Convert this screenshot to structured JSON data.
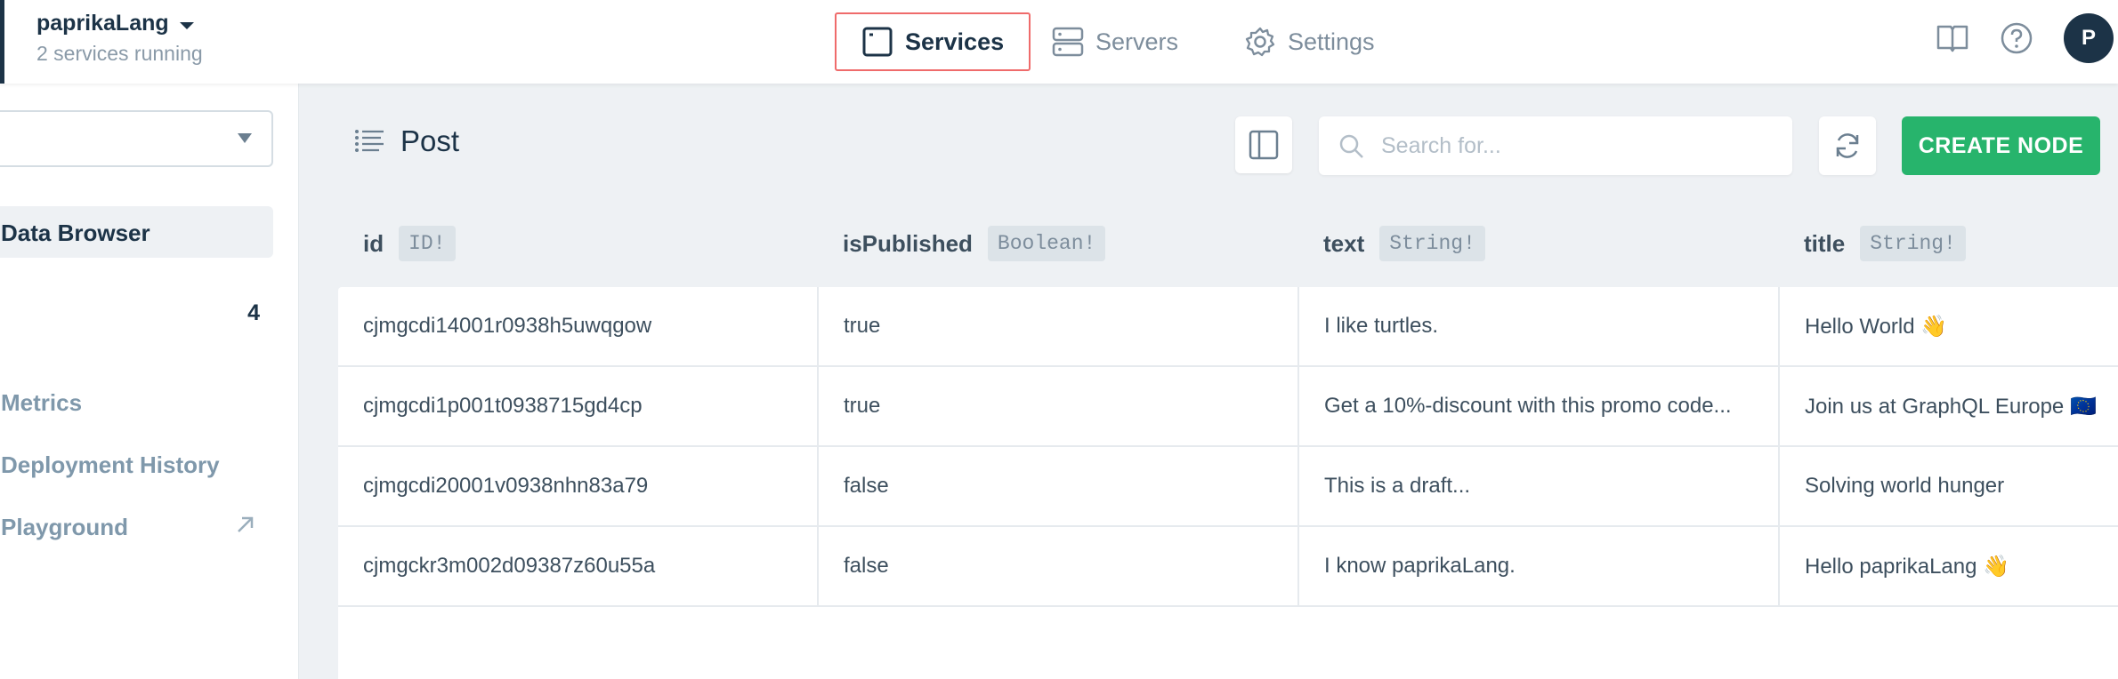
{
  "project": {
    "name": "paprikaLang",
    "status": "2 services running"
  },
  "nav": [
    {
      "label": "Services",
      "icon": "window-icon",
      "active": true
    },
    {
      "label": "Servers",
      "icon": "server-icon",
      "active": false
    },
    {
      "label": "Settings",
      "icon": "gear-icon",
      "active": false
    }
  ],
  "user": {
    "avatar_initial": "P"
  },
  "sidebar": {
    "active_item": "Data Browser",
    "model": {
      "label": ":",
      "count": "4"
    },
    "links": [
      "Metrics",
      "Deployment History",
      "Playground"
    ]
  },
  "main": {
    "model_title": "Post",
    "search_placeholder": "Search for...",
    "create_label": "CREATE NODE"
  },
  "table": {
    "columns": [
      {
        "name": "id",
        "type": "ID!"
      },
      {
        "name": "isPublished",
        "type": "Boolean!"
      },
      {
        "name": "text",
        "type": "String!"
      },
      {
        "name": "title",
        "type": "String!"
      }
    ],
    "rows": [
      [
        "cjmgcdi14001r0938h5uwqgow",
        "true",
        "I like turtles.",
        "Hello World 👋"
      ],
      [
        "cjmgcdi1p001t0938715gd4cp",
        "true",
        "Get a 10%-discount with this promo code...",
        "Join us at GraphQL Europe 🇪🇺"
      ],
      [
        "cjmgcdi20001v0938nhn83a79",
        "false",
        "This is a draft...",
        "Solving world hunger"
      ],
      [
        "cjmgckr3m002d09387z60u55a",
        "false",
        "I know paprikaLang.",
        "Hello paprikaLang 👋"
      ]
    ]
  },
  "colors": {
    "accent": "#27b46c",
    "highlight": "#ef6b6b",
    "dark": "#1c3347"
  }
}
